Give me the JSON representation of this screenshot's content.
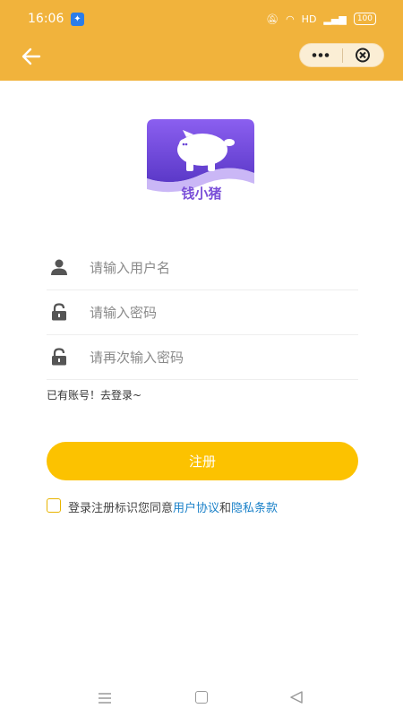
{
  "status_bar": {
    "time": "16:06",
    "network": "HD",
    "battery": "100"
  },
  "header": {
    "back_icon": "arrow-left-icon",
    "more_icon": "more-dots-icon",
    "close_icon": "close-circle-icon"
  },
  "app": {
    "name": "钱小猪",
    "logo_icon": "piggy-bank-icon",
    "logo_color": "#7a4fd8"
  },
  "form": {
    "username": {
      "value": "",
      "placeholder": "请输入用户名",
      "icon": "user-icon"
    },
    "password": {
      "value": "",
      "placeholder": "请输入密码",
      "icon": "lock-icon"
    },
    "password_confirm": {
      "value": "",
      "placeholder": "请再次输入密码",
      "icon": "lock-icon"
    }
  },
  "login_link": "已有账号！去登录~",
  "register_button": "注册",
  "agreement": {
    "checked": false,
    "text": "登录注册标识您同意",
    "terms_link": "用户协议",
    "and": "和",
    "privacy_link": "隐私条款"
  },
  "colors": {
    "header": "#f1b33c",
    "button": "#fcc200",
    "link": "#1c82c9"
  }
}
